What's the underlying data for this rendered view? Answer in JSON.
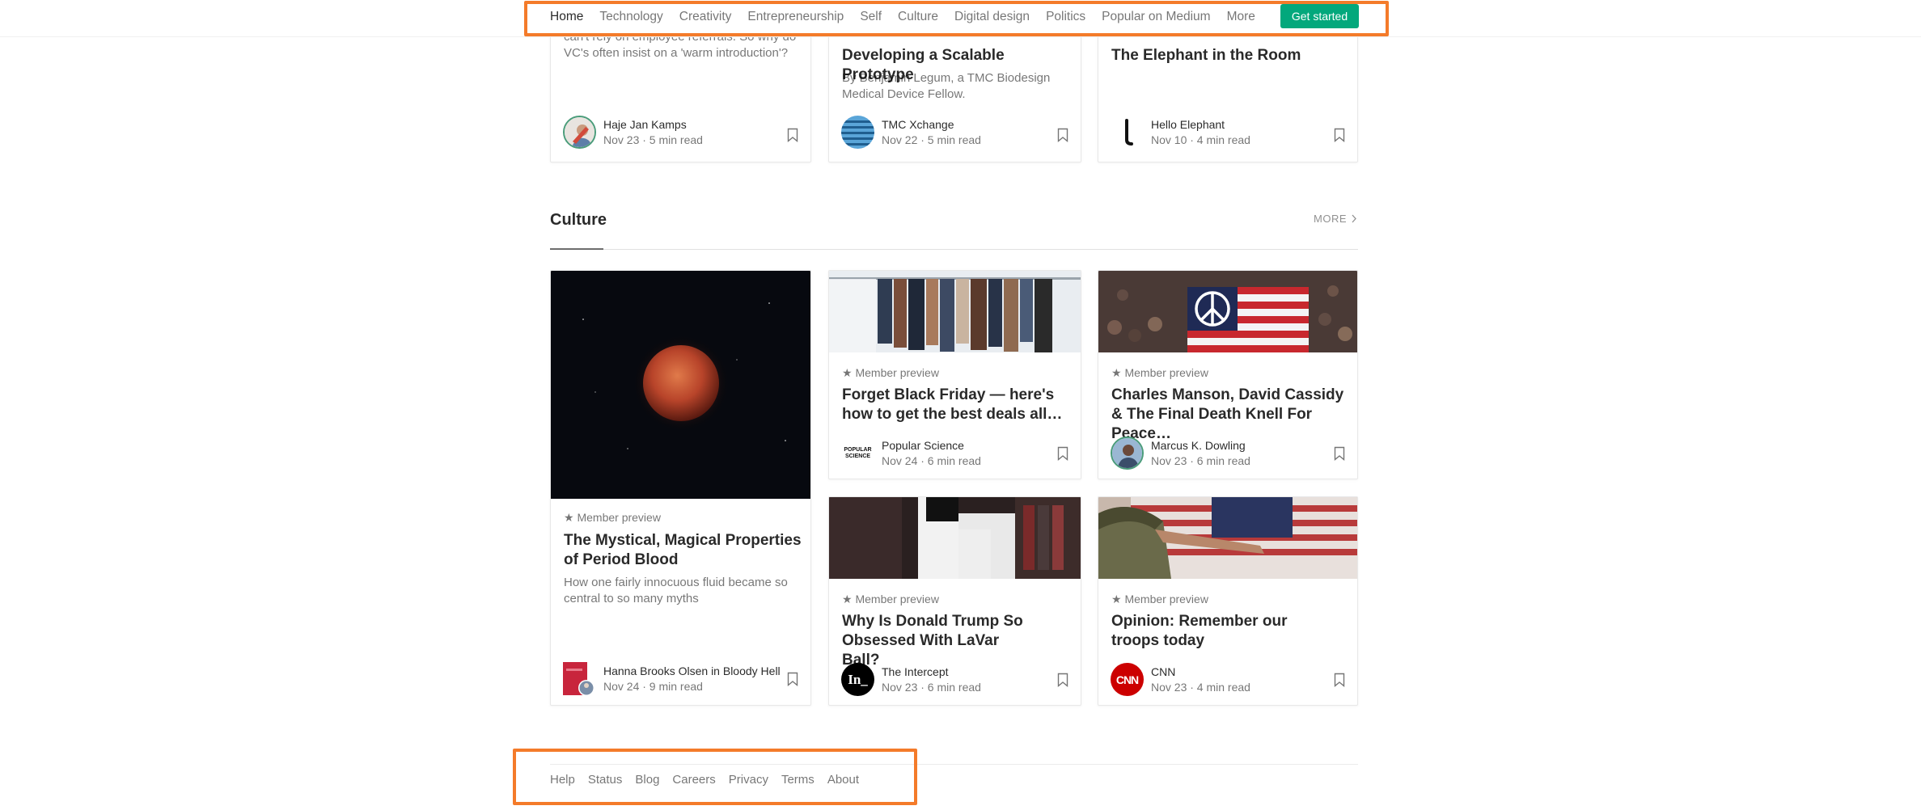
{
  "nav": {
    "items": [
      {
        "label": "Home",
        "active": true
      },
      {
        "label": "Technology"
      },
      {
        "label": "Creativity"
      },
      {
        "label": "Entrepreneurship"
      },
      {
        "label": "Self"
      },
      {
        "label": "Culture"
      },
      {
        "label": "Digital design"
      },
      {
        "label": "Politics"
      },
      {
        "label": "Popular on Medium"
      },
      {
        "label": "More"
      }
    ],
    "cta_label": "Get started",
    "cta_color": "#03a87c",
    "highlight_color": "#f47b2a"
  },
  "top_row": [
    {
      "subtitle": "can't rely on employee referrals. So why do VC's often insist on a 'warm introduction'?",
      "author": "Haje Jan Kamps",
      "meta": "Nov 23 · 5 min read"
    },
    {
      "title": "Developing a Scalable Prototype",
      "subtitle": "By Benjamin Legum, a TMC Biodesign Medical Device Fellow.",
      "author": "TMC Xchange",
      "meta": "Nov 22 · 5 min read"
    },
    {
      "title": "The Elephant in the Room",
      "author": "Hello Elephant",
      "meta": "Nov 10 · 4 min read"
    }
  ],
  "section": {
    "title": "Culture",
    "more_label": "MORE",
    "member_label": "Member preview",
    "featured": {
      "title": "The Mystical, Magical Properties of Period Blood",
      "subtitle": "How one fairly innocuous fluid became so central to so many myths",
      "author": "Hanna Brooks Olsen in Bloody Hell",
      "meta": "Nov 24 · 9 min read",
      "image_icon": "blood-moon-image"
    },
    "cards": [
      {
        "title": "Forget Black Friday — here's how to get the best deals all…",
        "author": "Popular Science",
        "meta": "Nov 24 · 6 min read",
        "avatar_text": "POPULAR SCIENCE",
        "image_icon": "clothes-rack-image"
      },
      {
        "title": "Charles Manson, David Cassidy & The Final Death Knell For Peace…",
        "author": "Marcus K. Dowling",
        "meta": "Nov 23 · 6 min read",
        "image_icon": "peace-flag-image"
      },
      {
        "title": "Why Is Donald Trump So Obsessed With LaVar Ball?",
        "author": "The Intercept",
        "meta": "Nov 23 · 6 min read",
        "avatar_text": "In_",
        "image_icon": "person-closet-image"
      },
      {
        "title": "Opinion: Remember our troops today",
        "author": "CNN",
        "meta": "Nov 23 · 4 min read",
        "avatar_text": "CNN",
        "image_icon": "soldier-salute-image"
      }
    ]
  },
  "footer": {
    "links": [
      "Help",
      "Status",
      "Blog",
      "Careers",
      "Privacy",
      "Terms",
      "About"
    ]
  }
}
